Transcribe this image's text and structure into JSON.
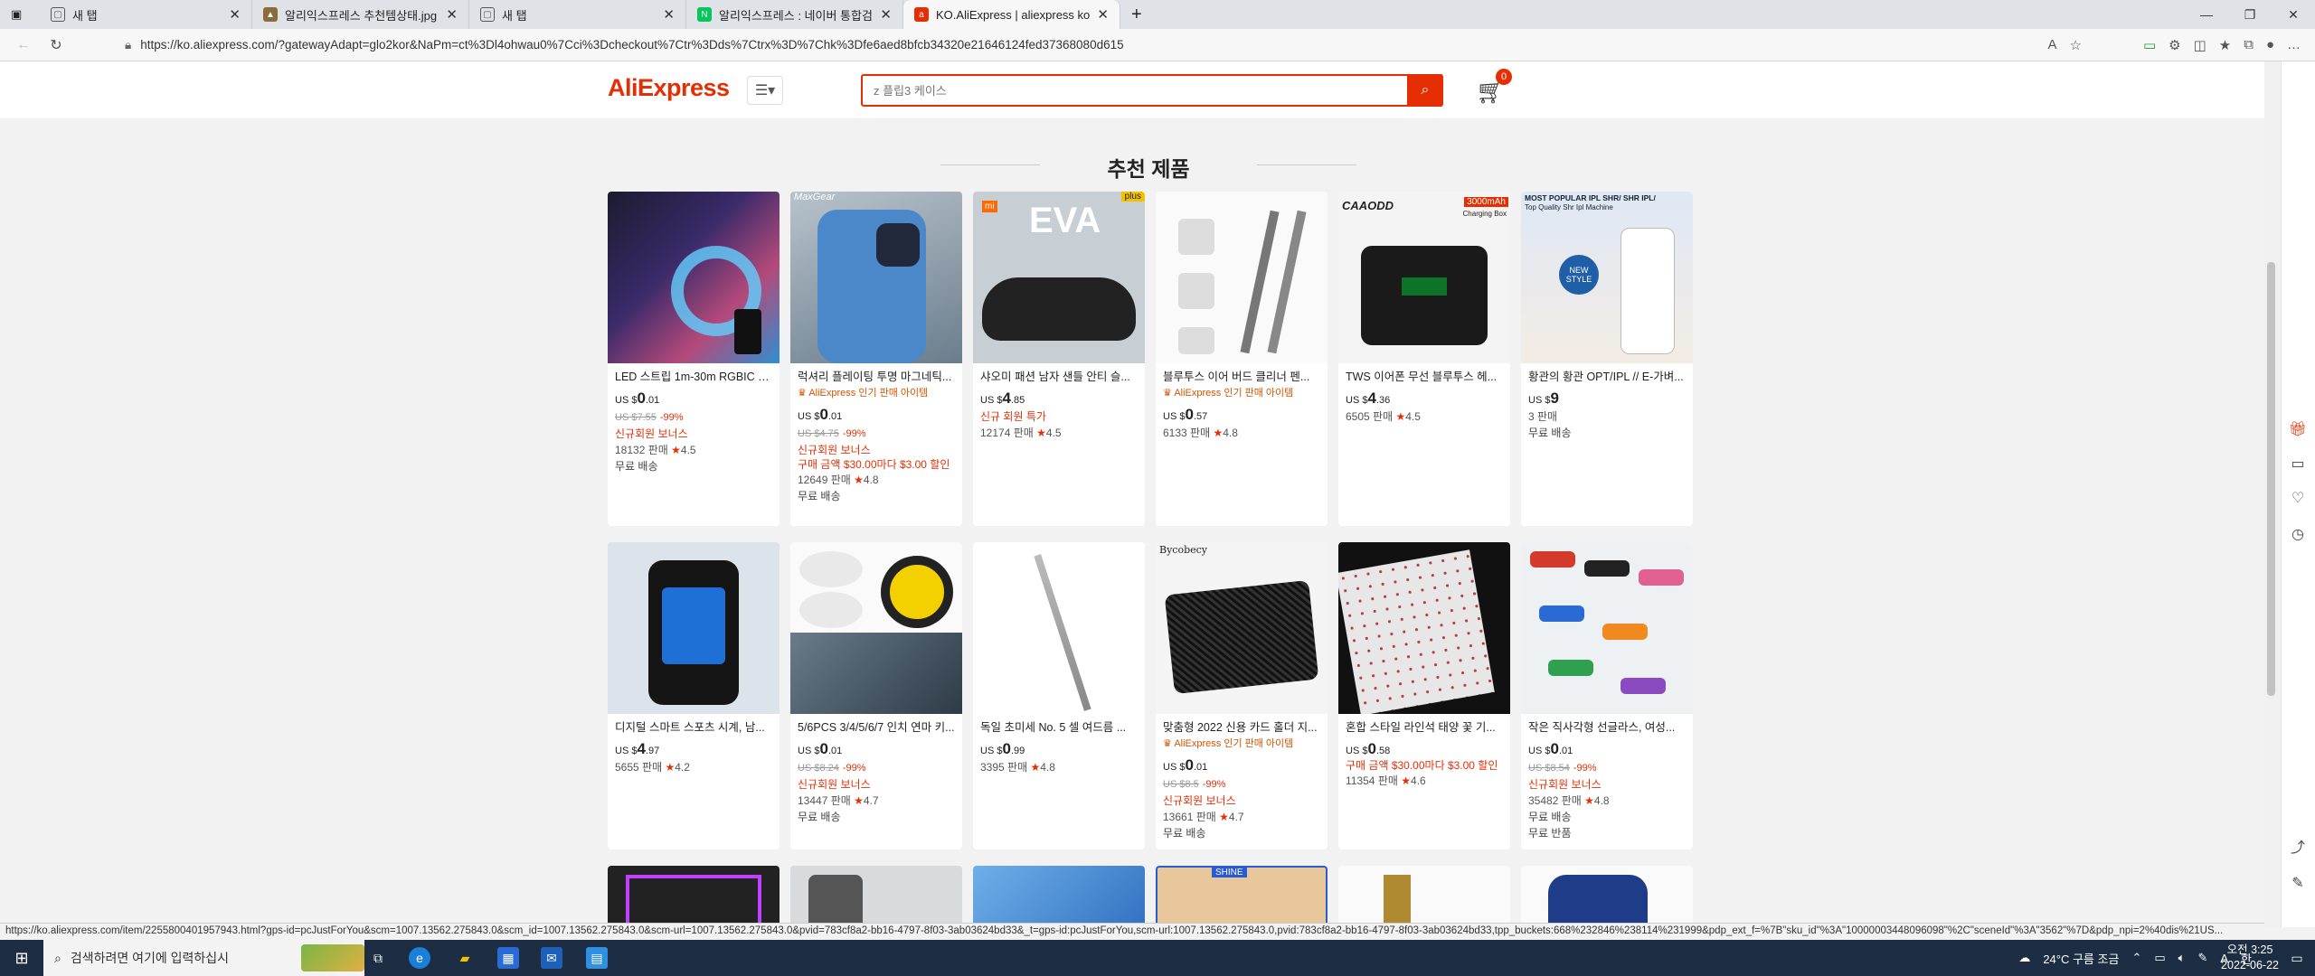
{
  "browser": {
    "tabs": [
      {
        "title": "새 탭",
        "favicon": "newtab-icon"
      },
      {
        "title": "알리익스프레스 추천템상태.jpg",
        "favicon": "image-icon"
      },
      {
        "title": "새 탭",
        "favicon": "newtab-icon"
      },
      {
        "title": "알리익스프레스 : 네이버 통합검",
        "favicon": "naver-icon"
      },
      {
        "title": "KO.AliExpress | aliexpress korean",
        "favicon": "aliexpress-icon"
      }
    ],
    "url": "https://ko.aliexpress.com/?gatewayAdapt=glo2kor&NaPm=ct%3Dl4ohwau0%7Cci%3Dcheckout%7Ctr%3Dds%7Ctrx%3D%7Chk%3Dfe6aed8bfcb34320e21646124fed37368080d615"
  },
  "header": {
    "logo": "AliExpress",
    "search_placeholder": "z 플립3 케이스",
    "cart_count": "0"
  },
  "section_title": "추천 제품",
  "products": [
    {
      "name": "LED 스트립 1m-30m RGBIC WiFi...",
      "currency": "US $",
      "price": "0",
      "price_dec": ".01",
      "old_price": "US $7.55",
      "discount": "-99%",
      "promo": "신규회원 보너스",
      "sold": "18132 판매",
      "rating": "4.5",
      "shipping": "무료 배송"
    },
    {
      "name": "럭셔리 플레이팅 투명 마그네틱...",
      "choice": "AliExpress 인기 판매 아이템",
      "currency": "US $",
      "price": "0",
      "price_dec": ".01",
      "old_price": "US $4.75",
      "discount": "-99%",
      "promo": "신규회원 보너스",
      "promo2": "구매 금액 $30.00마다 $3.00 할인",
      "sold": "12649 판매",
      "rating": "4.8",
      "shipping": "무료 배송"
    },
    {
      "name": "샤오미 패션 남자 샌들 안티 슬...",
      "currency": "US $",
      "price": "4",
      "price_dec": ".85",
      "promo": "신규 회원 특가",
      "sold": "12174 판매",
      "rating": "4.5"
    },
    {
      "name": "블루투스 이어 버드 클리너 펜...",
      "choice": "AliExpress 인기 판매 아이템",
      "currency": "US $",
      "price": "0",
      "price_dec": ".57",
      "sold": "6133 판매",
      "rating": "4.8"
    },
    {
      "name": "TWS 이어폰 무선 블루투스 헤...",
      "currency": "US $",
      "price": "4",
      "price_dec": ".36",
      "sold": "6505 판매",
      "rating": "4.5"
    },
    {
      "name": "황관의 황관 OPT/IPL // E-가벼...",
      "currency": "US $",
      "price": "9",
      "price_dec": "",
      "sold": "3 판매",
      "shipping": "무료 배송"
    },
    {
      "name": "디지털 스마트 스포츠 시계, 남...",
      "currency": "US $",
      "price": "4",
      "price_dec": ".97",
      "sold": "5655 판매",
      "rating": "4.2"
    },
    {
      "name": "5/6PCS 3/4/5/6/7 인치 연마 키...",
      "currency": "US $",
      "price": "0",
      "price_dec": ".01",
      "old_price": "US $8.24",
      "discount": "-99%",
      "promo": "신규회원 보너스",
      "sold": "13447 판매",
      "rating": "4.7",
      "shipping": "무료 배송"
    },
    {
      "name": "독일 초미세 No. 5 셀 여드름 ...",
      "currency": "US $",
      "price": "0",
      "price_dec": ".99",
      "sold": "3395 판매",
      "rating": "4.8"
    },
    {
      "name": "맞춤형 2022 신용 카드 홀더 지...",
      "choice": "AliExpress 인기 판매 아이템",
      "currency": "US $",
      "price": "0",
      "price_dec": ".01",
      "old_price": "US $8.5",
      "discount": "-99%",
      "promo": "신규회원 보너스",
      "sold": "13661 판매",
      "rating": "4.7",
      "shipping": "무료 배송"
    },
    {
      "name": "혼합 스타일 라인석 태양 꽃 기...",
      "currency": "US $",
      "price": "0",
      "price_dec": ".58",
      "promo2": "구매 금액 $30.00마다 $3.00 할인",
      "sold": "11354 판매",
      "rating": "4.6"
    },
    {
      "name": "작은 직사각형 선글라스, 여성...",
      "currency": "US $",
      "price": "0",
      "price_dec": ".01",
      "old_price": "US $8.54",
      "discount": "-99%",
      "promo": "신규회원 보너스",
      "sold": "35482 판매",
      "rating": "4.8",
      "shipping": "무료 배송",
      "returns": "무료 반품"
    }
  ],
  "image_labels": {
    "eva": "EVA",
    "mi": "mi",
    "plus": "plus",
    "caaodd": "CAAODD",
    "mah": "3000mAh",
    "mah_sub": "Charging Box",
    "ipl_head": "MOST POPULAR IPL SHR/ SHR IPL/",
    "ipl_sub": "Top Quality Shr Ipl Machine",
    "ipl_new": "NEW STYLE",
    "maxgear": "MaxGear",
    "bycobecy": "Bycobecy",
    "shine": "SHINE"
  },
  "status_url": "https://ko.aliexpress.com/item/2255800401957943.html?gps-id=pcJustForYou&scm=1007.13562.275843.0&scm_id=1007.13562.275843.0&scm-url=1007.13562.275843.0&pvid=783cf8a2-bb16-4797-8f03-3ab03624bd33&_t=gps-id:pcJustForYou,scm-url:1007.13562.275843.0,pvid:783cf8a2-bb16-4797-8f03-3ab03624bd33,tpp_buckets:668%232846%238114%231999&pdp_ext_f=%7B\"sku_id\"%3A\"10000003448096098\"%2C\"sceneId\"%3A\"3562\"%7D&pdp_npi=2%40dis%21US...",
  "taskbar": {
    "search_placeholder": "검색하려면 여기에 입력하십시",
    "weather": "24°C 구름 조금",
    "time": "오전 3:25",
    "date": "2022-06-22"
  },
  "colors": {
    "accent": "#e62e04",
    "taskbar": "#1c2d44"
  }
}
